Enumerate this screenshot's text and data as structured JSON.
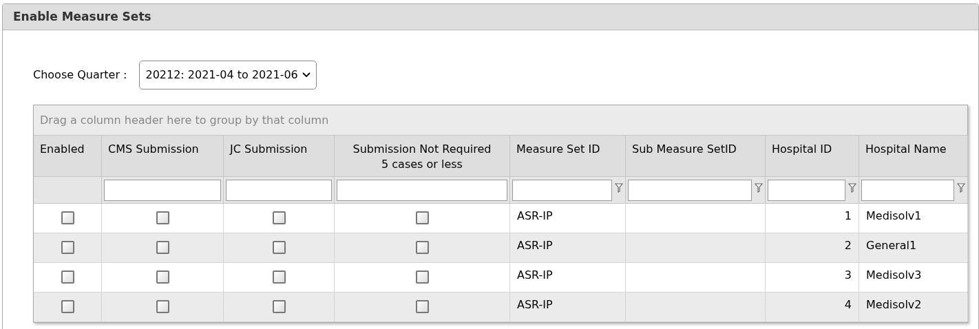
{
  "panel": {
    "title": "Enable Measure Sets"
  },
  "quarter": {
    "label": "Choose Quarter :",
    "value": "20212: 2021-04 to 2021-06"
  },
  "grid": {
    "group_hint": "Drag a column header here to group by that column",
    "columns": [
      {
        "label": "Enabled",
        "kind": "check",
        "filter_field": false,
        "filter_button": false
      },
      {
        "label": "CMS Submission",
        "kind": "check",
        "filter_field": true,
        "filter_button": false
      },
      {
        "label": "JC Submission",
        "kind": "check",
        "filter_field": true,
        "filter_button": false
      },
      {
        "label": "Submission Not Required",
        "sublabel": "5 cases or less",
        "kind": "check",
        "filter_field": true,
        "filter_button": false
      },
      {
        "label": "Measure Set ID",
        "kind": "text",
        "filter_field": true,
        "filter_button": true
      },
      {
        "label": "Sub Measure SetID",
        "kind": "text",
        "filter_field": true,
        "filter_button": true
      },
      {
        "label": "Hospital ID",
        "kind": "number",
        "filter_field": true,
        "filter_button": true
      },
      {
        "label": "Hospital Name",
        "kind": "text",
        "filter_field": true,
        "filter_button": true
      }
    ],
    "rows": [
      {
        "cells": [
          {
            "checked": false
          },
          {
            "checked": false
          },
          {
            "checked": false
          },
          {
            "checked": false
          },
          {
            "text": "ASR-IP"
          },
          {},
          {
            "text": "1"
          },
          {
            "text": "Medisolv1"
          }
        ]
      },
      {
        "cells": [
          {
            "checked": false
          },
          {
            "checked": false
          },
          {
            "checked": false
          },
          {
            "checked": false
          },
          {
            "text": "ASR-IP"
          },
          {},
          {
            "text": "2"
          },
          {
            "text": "General1"
          }
        ]
      },
      {
        "cells": [
          {
            "checked": false
          },
          {
            "checked": false
          },
          {
            "checked": false
          },
          {
            "checked": false
          },
          {
            "text": "ASR-IP"
          },
          {},
          {
            "text": "3"
          },
          {
            "text": "Medisolv3"
          }
        ]
      },
      {
        "cells": [
          {
            "checked": false
          },
          {
            "checked": false
          },
          {
            "checked": false
          },
          {
            "checked": false
          },
          {
            "text": "ASR-IP"
          },
          {},
          {
            "text": "4"
          },
          {
            "text": "Medisolv2"
          }
        ]
      }
    ]
  }
}
